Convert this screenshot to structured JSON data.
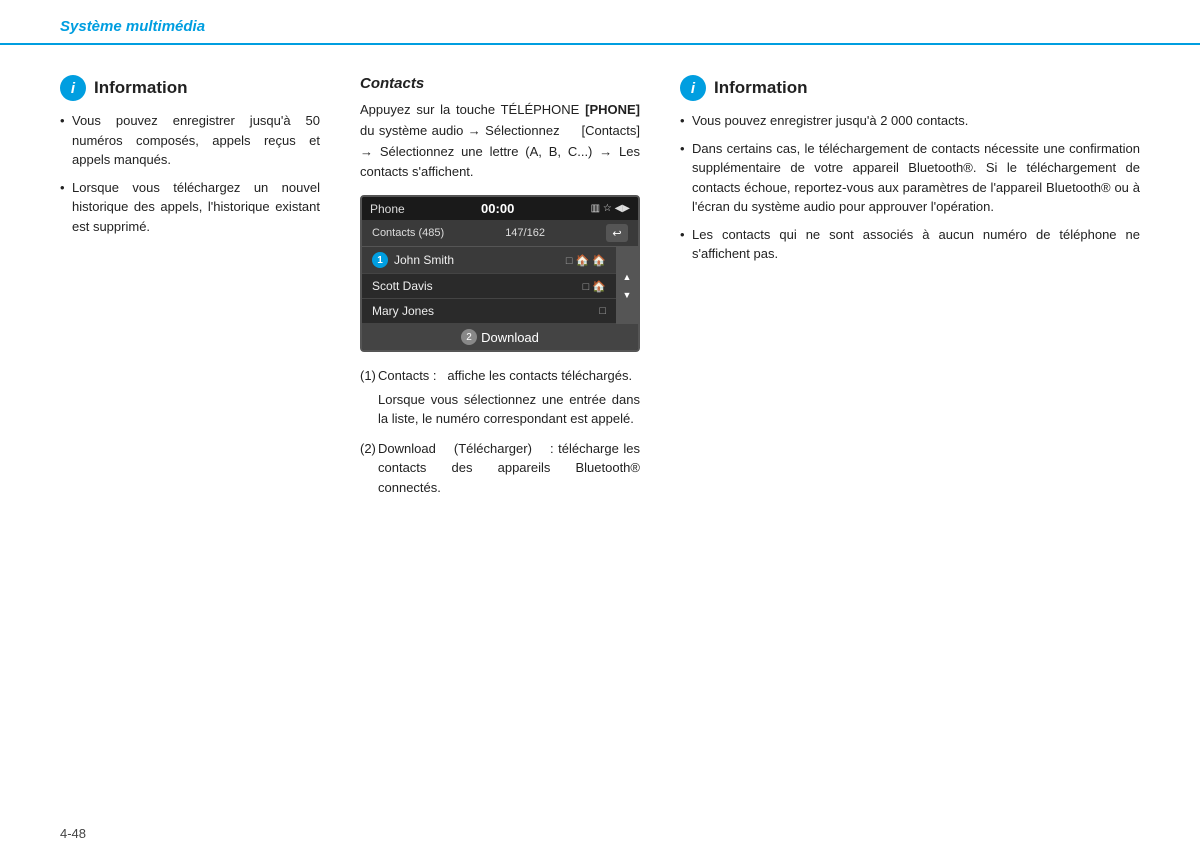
{
  "header": {
    "title": "Système multimédia"
  },
  "left_column": {
    "info_title": "Information",
    "bullets": [
      "Vous pouvez enregistrer jusqu'à 50 numéros composés, appels reçus et appels manqués.",
      "Lorsque vous téléchargez un nouvel historique des appels, l'historique existant est supprimé."
    ]
  },
  "middle_column": {
    "section_title": "Contacts",
    "instruction": "Appuyez sur la touche TÉLÉPHONE [PHONE] du système audio → Sélectionnez [Contacts] → Sélectionnez une lettre (A, B, C...) → Les contacts s'affichent.",
    "phone_screen": {
      "top_bar_left": "Phone",
      "top_bar_center": "00:00",
      "top_bar_right": "📶 🔵 ▶",
      "contacts_label": "Contacts (485)",
      "contacts_page": "147/162",
      "contacts": [
        {
          "name": "John Smith",
          "icons": "□ 🏠 🏠",
          "selected": true,
          "number": "1"
        },
        {
          "name": "Scott Davis",
          "icons": "□ 🏠",
          "selected": false
        },
        {
          "name": "Mary Jones",
          "icons": "□",
          "selected": false
        }
      ],
      "download_label": "Download",
      "download_num": "2"
    },
    "notes": [
      {
        "num": "(1)",
        "main": "Contacts :   affiche les contacts téléchargés.",
        "sub": "Lorsque vous sélectionnez une entrée dans la liste, le numéro correspondant est appelé."
      },
      {
        "num": "(2)",
        "main": "Download   (Télécharger)   :  télécharge les contacts des appareils Bluetooth® connectés."
      }
    ]
  },
  "right_column": {
    "info_title": "Information",
    "bullets": [
      "Vous pouvez enregistrer jusqu'à 2 000 contacts.",
      "Dans certains cas, le téléchargement de contacts nécessite une confirmation supplémentaire de votre appareil Bluetooth®. Si le téléchargement de contacts échoue, reportez-vous aux paramètres de l'appareil Bluetooth® ou à l'écran du système audio pour approuver l'opération.",
      "Les contacts qui ne sont associés à aucun numéro de téléphone ne s'affichent pas."
    ]
  },
  "footer": {
    "page_number": "4-48"
  },
  "icons": {
    "info": "i"
  },
  "colors": {
    "accent": "#009ee0"
  }
}
